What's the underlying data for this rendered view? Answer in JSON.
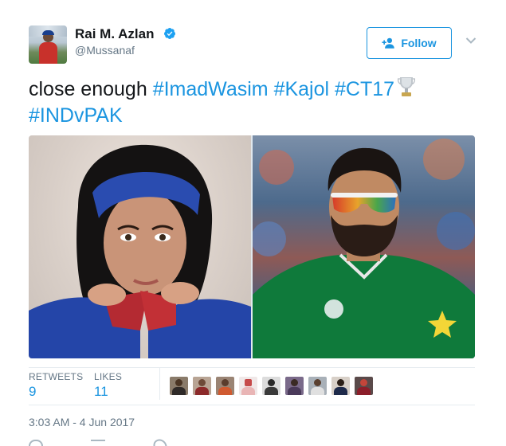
{
  "author": {
    "name": "Rai M. Azlan",
    "handle": "@Mussanaf",
    "verified": true,
    "avatar_icon": "profile-photo"
  },
  "follow_button": {
    "label": "Follow",
    "icon": "add-user-icon"
  },
  "menu_icon": "chevron-down-icon",
  "tweet": {
    "text_plain": "close enough",
    "hashtags": [
      "#ImadWasim",
      "#Kajol",
      "#CT17",
      "#INDvPAK"
    ],
    "emoji": "trophy-icon"
  },
  "media": {
    "left_photo": "woman-headband-photo",
    "right_photo": "cricketer-sunglasses-photo"
  },
  "stats": {
    "retweets_label": "RETWEETS",
    "retweets_value": "9",
    "likes_label": "LIKES",
    "likes_value": "11",
    "likers_count": 9
  },
  "timestamp": "3:03 AM - 4 Jun 2017",
  "colors": {
    "accent": "#1b95e0",
    "text": "#14171a",
    "muted": "#657786",
    "border": "#e6ecf0"
  }
}
